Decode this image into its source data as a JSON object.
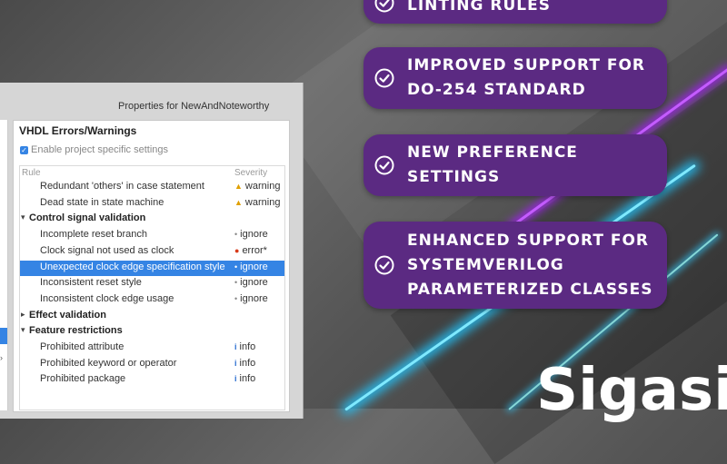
{
  "banners": [
    {
      "lines": [
        "LINTING RULES"
      ],
      "icon": "check-circle-icon"
    },
    {
      "lines": [
        "IMPROVED SUPPORT FOR",
        "DO-254 STANDARD"
      ],
      "icon": "check-circle-icon"
    },
    {
      "lines": [
        "NEW PREFERENCE",
        "SETTINGS"
      ],
      "icon": "check-circle-icon"
    },
    {
      "lines": [
        "ENHANCED SUPPORT FOR",
        "SYSTEMVERILOG",
        "PARAMETERIZED CLASSES"
      ],
      "icon": "check-circle-icon"
    }
  ],
  "brand": {
    "text": "Sigasi:"
  },
  "colors": {
    "banner_bg": "#5b2a82",
    "selection": "#3584e4",
    "warning": "#e0a000",
    "error": "#d83a1a",
    "info": "#2a6ed0"
  },
  "dialog": {
    "title": "Properties for NewAndNoteworthy",
    "page_heading": "VHDL Errors/Warnings",
    "enable_label": "Enable project specific settings",
    "enable_checked": true,
    "columns": {
      "rule": "Rule",
      "severity": "Severity"
    },
    "rows": [
      {
        "type": "rule",
        "label": "Redundant 'others' in case statement",
        "severity": "warning",
        "severity_icon": "warning-icon"
      },
      {
        "type": "rule",
        "label": "Dead state in state machine",
        "severity": "warning",
        "severity_icon": "warning-icon"
      },
      {
        "type": "group",
        "label": "Control signal validation",
        "expanded": true,
        "twisty": "▾"
      },
      {
        "type": "rule",
        "label": "Incomplete reset branch",
        "severity": "ignore",
        "severity_icon": "ignore-icon"
      },
      {
        "type": "rule",
        "label": "Clock signal not used as clock",
        "severity": "error*",
        "severity_icon": "error-icon"
      },
      {
        "type": "rule",
        "label": "Unexpected clock edge specification style",
        "severity": "ignore",
        "severity_icon": "ignore-icon",
        "selected": true
      },
      {
        "type": "rule",
        "label": "Inconsistent reset style",
        "severity": "ignore",
        "severity_icon": "ignore-icon"
      },
      {
        "type": "rule",
        "label": "Inconsistent clock edge usage",
        "severity": "ignore",
        "severity_icon": "ignore-icon"
      },
      {
        "type": "group",
        "label": "Effect validation",
        "expanded": false,
        "twisty": "▸"
      },
      {
        "type": "group",
        "label": "Feature restrictions",
        "expanded": true,
        "twisty": "▾"
      },
      {
        "type": "rule",
        "label": "Prohibited attribute",
        "severity": "info",
        "severity_icon": "info-icon"
      },
      {
        "type": "rule",
        "label": "Prohibited keyword or operator",
        "severity": "info",
        "severity_icon": "info-icon"
      },
      {
        "type": "rule",
        "label": "Prohibited package",
        "severity": "info",
        "severity_icon": "info-icon"
      }
    ]
  }
}
